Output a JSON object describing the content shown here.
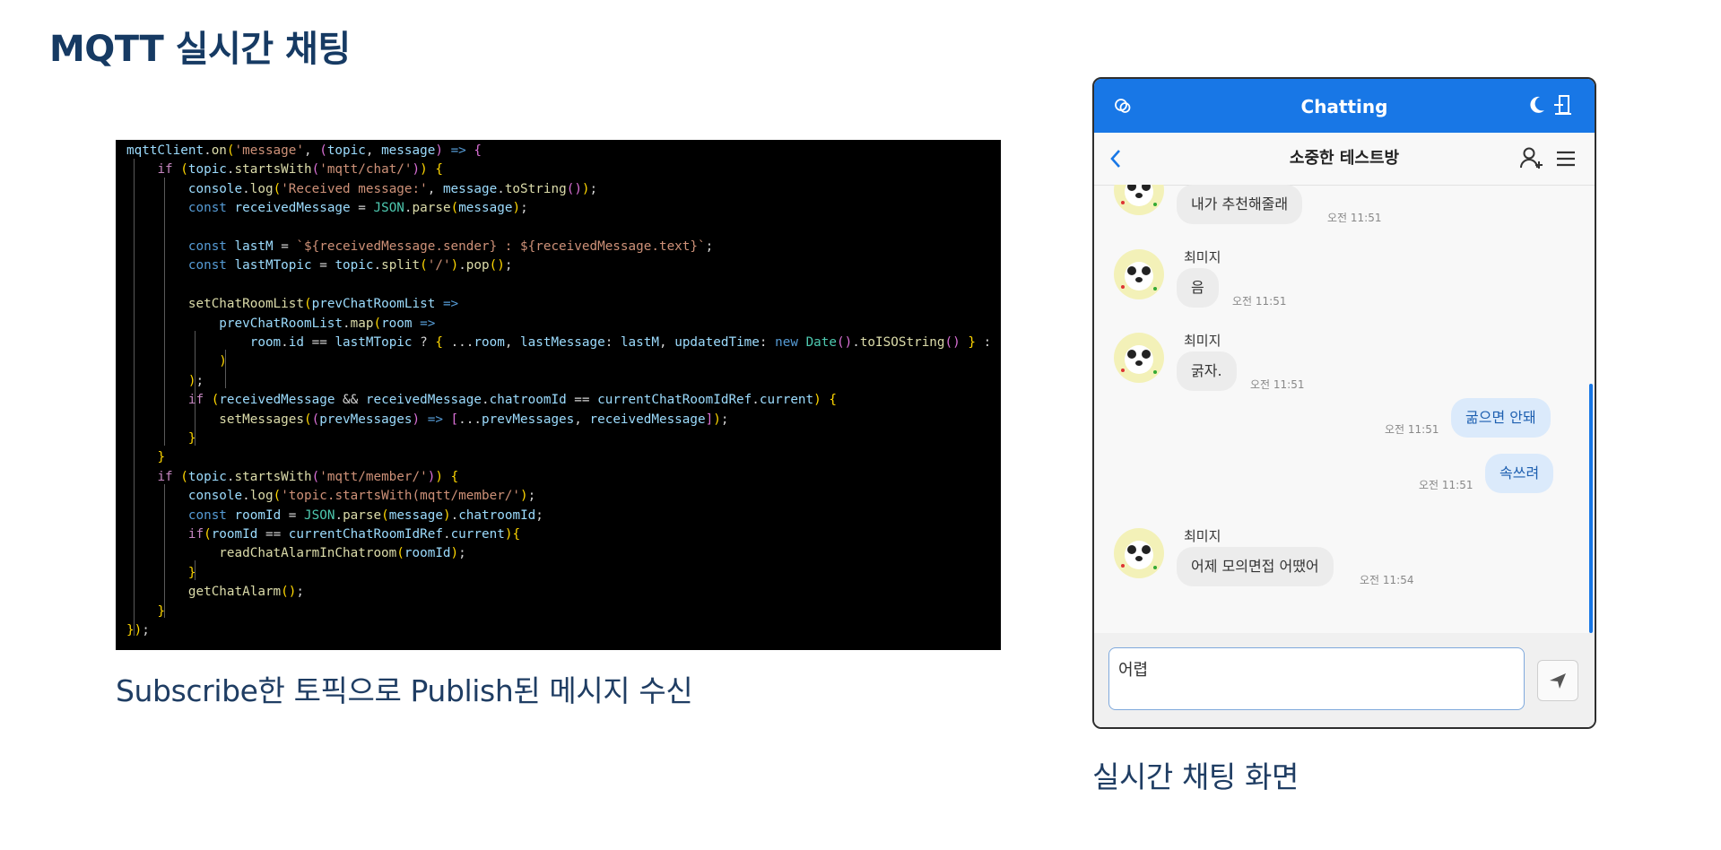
{
  "page": {
    "title": "MQTT 실시간 채팅",
    "code_caption": "Subscribe한 토픽으로 Publish된 메시지 수신",
    "chat_caption": "실시간 채팅 화면"
  },
  "code": {
    "lines": [
      "mqttClient.on('message', (topic, message) => {",
      "    if (topic.startsWith('mqtt/chat/')) {",
      "        console.log('Received message:', message.toString());",
      "        const receivedMessage = JSON.parse(message);",
      "",
      "        const lastM = `${receivedMessage.sender} : ${receivedMessage.text}`;",
      "        const lastMTopic = topic.split('/').pop();",
      "",
      "        setChatRoomList(prevChatRoomList =>",
      "            prevChatRoomList.map(room =>",
      "                room.id == lastMTopic ? { ...room, lastMessage: lastM, updatedTime: new Date().toISOString() } :",
      "            )",
      "        );",
      "        if (receivedMessage && receivedMessage.chatroomId == currentChatRoomIdRef.current) {",
      "            setMessages((prevMessages) => [...prevMessages, receivedMessage]);",
      "        }",
      "    }",
      "    if (topic.startsWith('mqtt/member/')) {",
      "        console.log('topic.startsWith(mqtt/member/');",
      "        const roomId = JSON.parse(message).chatroomId;",
      "        if(roomId == currentChatRoomIdRef.current){",
      "            readChatAlarmInChatroom(roomId);",
      "        }",
      "        getChatAlarm();",
      "    }",
      "});"
    ]
  },
  "chat": {
    "app_title": "Chatting",
    "room_title": "소중한 테스트방",
    "input_value": "어렵",
    "colors": {
      "accent": "#1877e6",
      "bubble_out": "#dbeafb",
      "bubble_in": "#ececec"
    },
    "icons": {
      "app": "chat-logo-icon",
      "theme": "moon-icon",
      "logout": "exit-door-icon",
      "back": "chevron-left-icon",
      "invite": "add-user-icon",
      "menu": "hamburger-menu-icon",
      "send": "paper-plane-icon"
    },
    "messages": [
      {
        "dir": "in",
        "show_sender": false,
        "sender": "",
        "text": "내가 추천해줄래",
        "time": "오전 11:51"
      },
      {
        "dir": "in",
        "show_sender": true,
        "sender": "최미지",
        "text": "음",
        "time": "오전 11:51"
      },
      {
        "dir": "in",
        "show_sender": true,
        "sender": "최미지",
        "text": "굵자.",
        "time": "오전 11:51"
      },
      {
        "dir": "out",
        "text": "굶으면 안돼",
        "time": "오전 11:51"
      },
      {
        "dir": "out",
        "text": "속쓰려",
        "time": "오전 11:51"
      },
      {
        "dir": "in",
        "show_sender": true,
        "sender": "최미지",
        "text": "어제 모의면접 어땠어",
        "time": "오전 11:54"
      }
    ]
  }
}
